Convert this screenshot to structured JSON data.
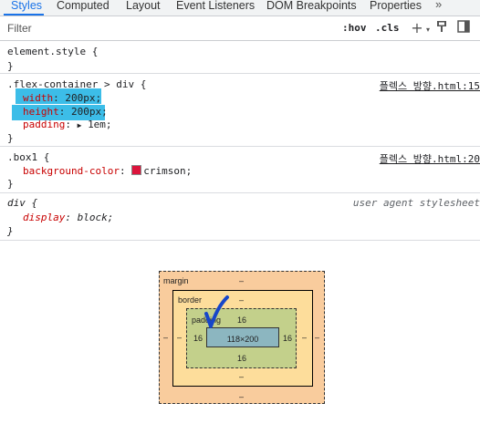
{
  "tabs": [
    {
      "label": "Styles",
      "active": true
    },
    {
      "label": "Computed"
    },
    {
      "label": "Layout"
    },
    {
      "label": "Event Listeners"
    },
    {
      "label": "DOM Breakpoints"
    },
    {
      "label": "Properties"
    }
  ],
  "tabs_more": "»",
  "filter": {
    "placeholder": "Filter",
    "hov": ":hov",
    "cls": ".cls",
    "plus": "+"
  },
  "rules": [
    {
      "selector": "element.style {",
      "close": "}"
    },
    {
      "selector": ".flex-container > div {",
      "source": "플렉스 방향.html:15",
      "props": [
        {
          "name": "width",
          "value": "200px;"
        },
        {
          "name": "height",
          "value": "200px;"
        },
        {
          "name": "padding",
          "value": "1em;"
        }
      ],
      "close": "}"
    },
    {
      "selector": ".box1 {",
      "source": "플렉스 방향.html:20",
      "props": [
        {
          "name": "background-color",
          "value": "crimson;",
          "swatch": "#dc143c"
        }
      ],
      "close": "}"
    },
    {
      "selector": "div {",
      "source": "user agent stylesheet",
      "props": [
        {
          "name": "display",
          "value": "block;"
        }
      ],
      "close": "}"
    }
  ],
  "box_model": {
    "margin_label": "margin",
    "margin_top": "–",
    "margin_bottom": "–",
    "margin_left": "–",
    "margin_right": "–",
    "border_label": "border",
    "border_top": "–",
    "border_bottom": "–",
    "border_left": "–",
    "border_right": "–",
    "padding_label": "padding",
    "padding_top": "16",
    "padding_bottom": "16",
    "padding_left": "16",
    "padding_right": "16",
    "content": "118×200"
  },
  "colors": {
    "accent": "#1a73e8",
    "highlight": "#3cbde8",
    "checkmark": "#1746c9"
  }
}
